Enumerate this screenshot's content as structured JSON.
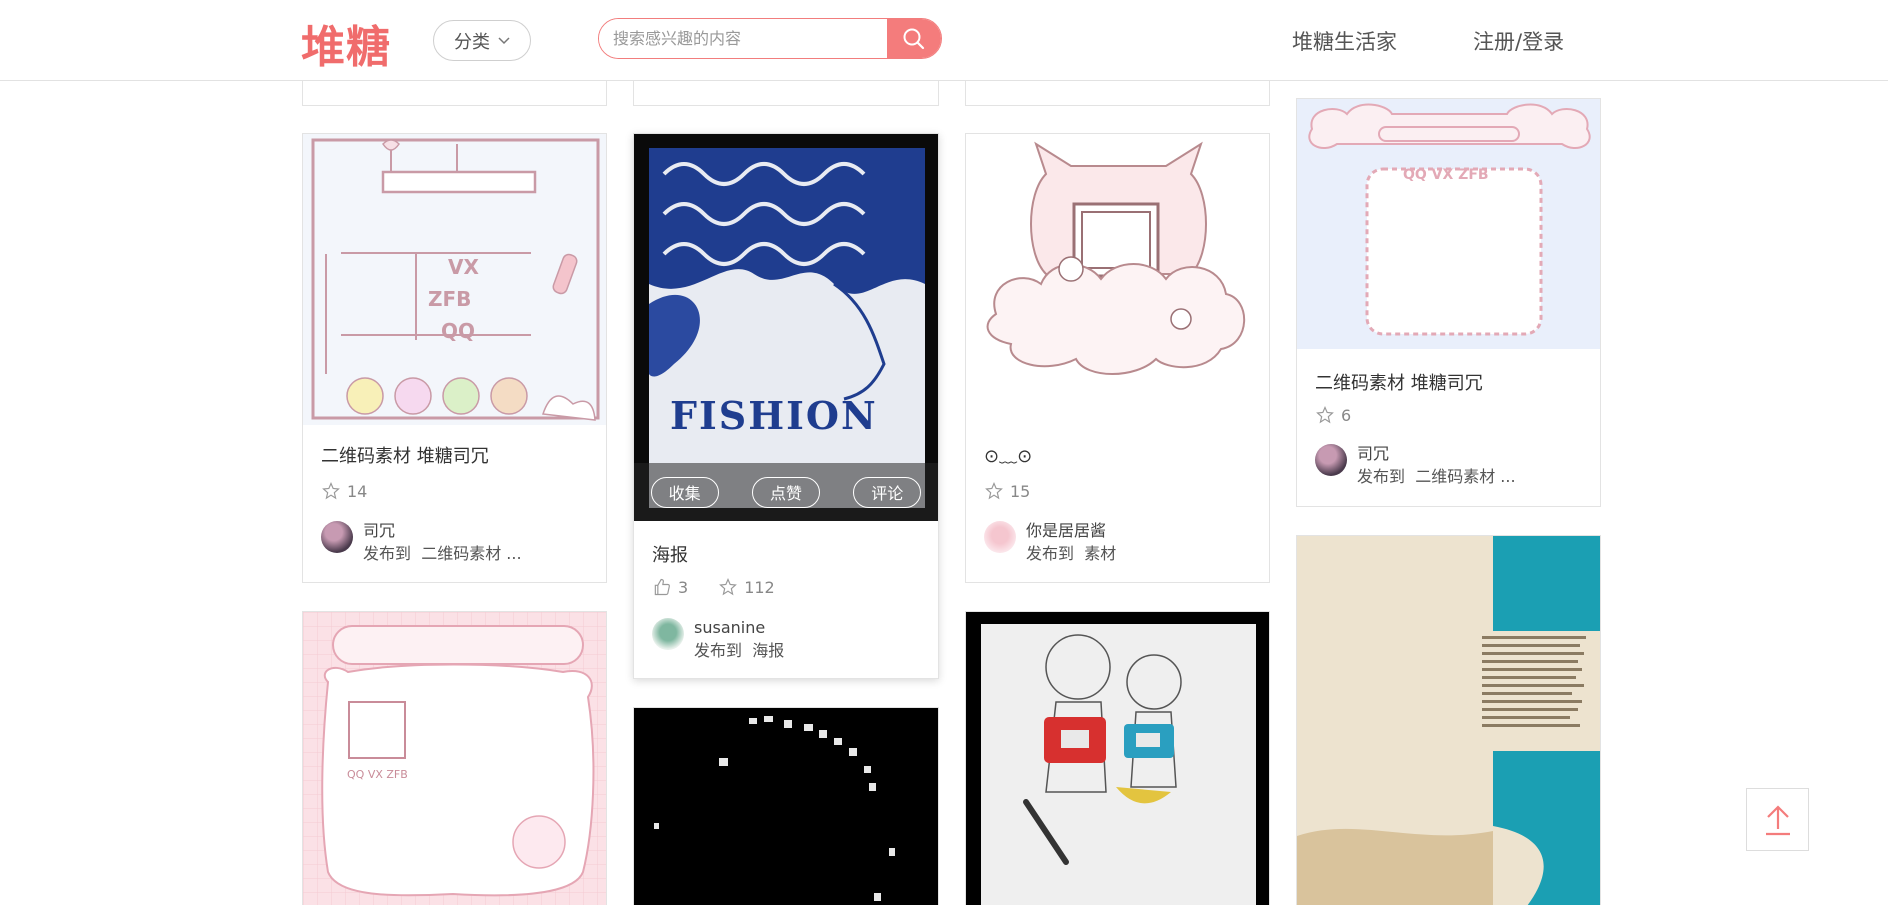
{
  "header": {
    "logo": "堆糖",
    "category_label": "分类",
    "search_placeholder": "搜索感兴趣的内容",
    "nav_home": "堆糖生活家",
    "nav_login": "注册/登录",
    "accent_color": "#f47c7c"
  },
  "cards": [
    {
      "title": "二维码素材 堆糖司冗",
      "stars": "14",
      "author": "司冗",
      "publish_prefix": "发布到",
      "album": "二维码素材 ..."
    },
    {
      "title": "海报",
      "likes": "3",
      "stars": "112",
      "author": "susanine",
      "publish_prefix": "发布到",
      "album": "海报",
      "actions": {
        "collect": "收集",
        "like": "点赞",
        "comment": "评论"
      },
      "poster_word": "FISHION"
    },
    {
      "title": "⊙﹏⊙",
      "stars": "15",
      "author": "你是居居酱",
      "publish_prefix": "发布到",
      "album": "素材"
    },
    {
      "title": "二维码素材 堆糖司冗",
      "stars": "6",
      "author": "司冗",
      "publish_prefix": "发布到",
      "album": "二维码素材 ..."
    }
  ],
  "image_text": {
    "qr_frame_labels": [
      "VX",
      "ZFB",
      "QQ"
    ],
    "pink_card_labels": "QQ VX ZFB",
    "blue_frame_label": "QQ VX ZFB"
  },
  "icons": {
    "search": "search-icon",
    "chevron": "chevron-down-icon",
    "star": "star-icon",
    "thumb": "thumb-up-icon",
    "back_to_top": "arrow-up-icon"
  }
}
